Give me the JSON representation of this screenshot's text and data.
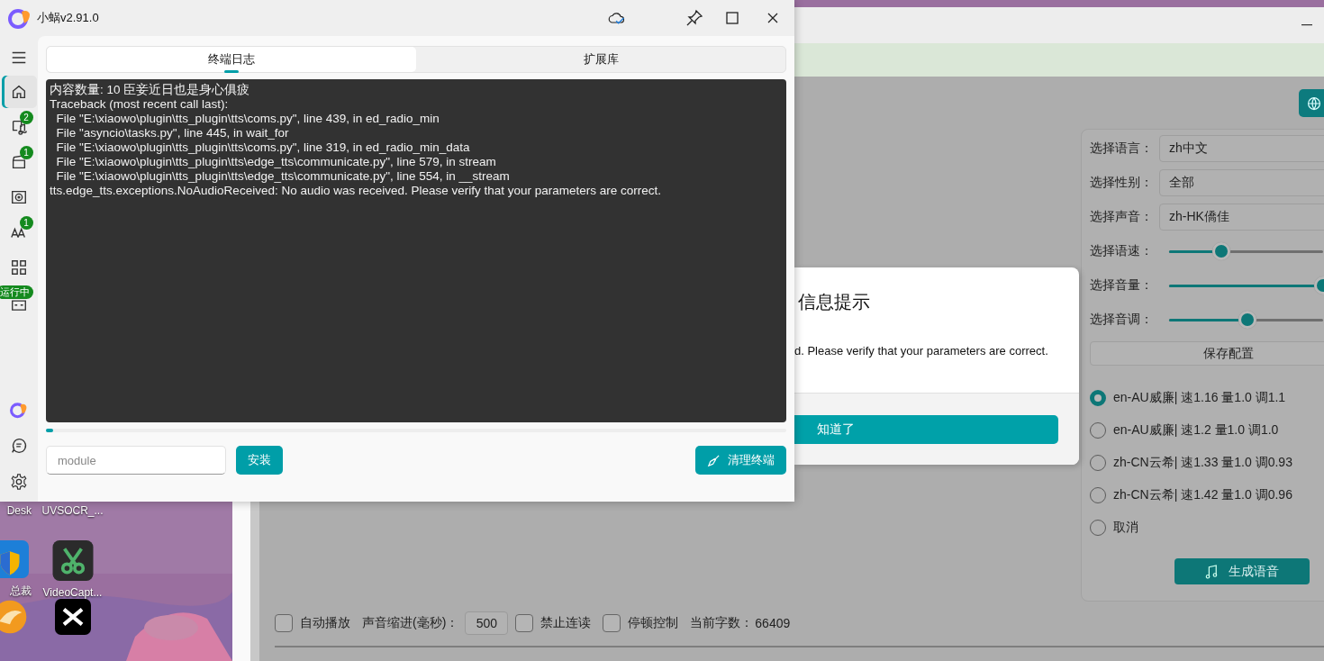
{
  "window": {
    "title": "小蜗v2.91.0"
  },
  "sidebar": {
    "items": [
      {
        "selected": true
      },
      {
        "selected": false,
        "badge": "2"
      },
      {
        "selected": false,
        "badge": "1"
      },
      {
        "selected": false
      },
      {
        "selected": false,
        "badge": "1"
      },
      {
        "selected": false
      },
      {
        "selected": false,
        "badge": "运行中"
      }
    ]
  },
  "tabs": [
    {
      "label": "终端日志",
      "selected": true
    },
    {
      "label": "扩展库",
      "selected": false
    }
  ],
  "terminal": {
    "lines": [
      "内容数量: 10 臣妾近日也是身心俱疲",
      "Traceback (most recent call last):",
      "  File \"E:\\xiaowo\\plugin\\tts_plugin\\tts\\coms.py\", line 439, in ed_radio_min",
      "  File \"asyncio\\tasks.py\", line 445, in wait_for",
      "  File \"E:\\xiaowo\\plugin\\tts_plugin\\tts\\coms.py\", line 319, in ed_radio_min_data",
      "  File \"E:\\xiaowo\\plugin\\tts_plugin\\tts\\edge_tts\\communicate.py\", line 579, in stream",
      "  File \"E:\\xiaowo\\plugin\\tts_plugin\\tts\\edge_tts\\communicate.py\", line 554, in __stream",
      "tts.edge_tts.exceptions.NoAudioReceived: No audio was received. Please verify that your parameters are correct."
    ]
  },
  "progress": {
    "level": 0.01
  },
  "module_field": {
    "placeholder": "module"
  },
  "install_button": "安装",
  "clear_button": "清理终端",
  "dialog": {
    "title": "信息提示",
    "message": "d. Please verify that your parameters are correct.",
    "button": "知道了"
  },
  "voice_panel": {
    "selects": [
      {
        "label": "选择语言：",
        "value": "zh中文"
      },
      {
        "label": "选择性别：",
        "value": "全部"
      },
      {
        "label": "选择声音：",
        "value": "zh-HK僑佳"
      }
    ],
    "sliders": [
      {
        "label": "选择语速：",
        "level": 0.34
      },
      {
        "label": "选择音量：",
        "level": 1
      },
      {
        "label": "选择音调：",
        "level": 0.51
      }
    ],
    "save_button": "保存配置",
    "presets": [
      {
        "label": "en-AU威廉| 速1.16 量1.0 调1.1",
        "selected": true
      },
      {
        "label": "en-AU威廉| 速1.2 量1.0 调1.0",
        "selected": false
      },
      {
        "label": "zh-CN云希| 速1.33 量1.0 调0.93",
        "selected": false
      },
      {
        "label": "zh-CN云希| 速1.42 量1.0 调0.96",
        "selected": false
      },
      {
        "label": "取消",
        "selected": false
      }
    ],
    "generate_button": "生成语音"
  },
  "options": [
    {
      "kind": "checkbox",
      "label": "自动播放",
      "checked": false
    },
    {
      "kind": "number",
      "label": "声音缩进(毫秒)：",
      "value": "500"
    },
    {
      "kind": "checkbox",
      "label": "禁止连读",
      "checked": false
    },
    {
      "kind": "checkbox",
      "label": "停顿控制",
      "checked": false
    },
    {
      "kind": "count",
      "label": "当前字数：",
      "value": "66409"
    }
  ],
  "desktop": {
    "icons": [
      {
        "label": "Desk"
      },
      {
        "label": "UVSOCR_..."
      },
      {
        "label": "总裁"
      },
      {
        "label": "VideoCapt..."
      }
    ]
  }
}
